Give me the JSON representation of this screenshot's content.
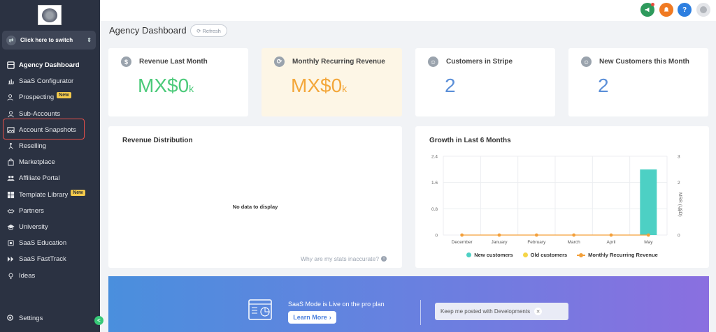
{
  "sidebar": {
    "switcher_label": "Click here to switch",
    "items": [
      {
        "label": "Agency Dashboard",
        "icon": "dashboard-icon",
        "active": true,
        "badge": ""
      },
      {
        "label": "SaaS Configurator",
        "icon": "chart-icon",
        "active": false,
        "badge": ""
      },
      {
        "label": "Prospecting",
        "icon": "users-search-icon",
        "active": false,
        "badge": "New"
      },
      {
        "label": "Sub-Accounts",
        "icon": "user-icon",
        "active": false,
        "badge": ""
      },
      {
        "label": "Account Snapshots",
        "icon": "image-icon",
        "active": false,
        "badge": ""
      },
      {
        "label": "Reselling",
        "icon": "network-icon",
        "active": false,
        "badge": ""
      },
      {
        "label": "Marketplace",
        "icon": "bag-icon",
        "active": false,
        "badge": ""
      },
      {
        "label": "Affiliate Portal",
        "icon": "group-icon",
        "active": false,
        "badge": ""
      },
      {
        "label": "Template Library",
        "icon": "templates-icon",
        "active": false,
        "badge": "New"
      },
      {
        "label": "Partners",
        "icon": "handshake-icon",
        "active": false,
        "badge": ""
      },
      {
        "label": "University",
        "icon": "graduation-icon",
        "active": false,
        "badge": ""
      },
      {
        "label": "SaaS Education",
        "icon": "education-icon",
        "active": false,
        "badge": ""
      },
      {
        "label": "SaaS FastTrack",
        "icon": "fast-forward-icon",
        "active": false,
        "badge": ""
      },
      {
        "label": "Ideas",
        "icon": "lightbulb-icon",
        "active": false,
        "badge": ""
      }
    ],
    "settings_label": "Settings",
    "collapse_glyph": "<"
  },
  "header": {
    "title": "Agency Dashboard",
    "refresh_label": "Refresh"
  },
  "stats": [
    {
      "label": "Revenue Last Month",
      "value": "MX$0",
      "suffix": "k",
      "icon": "dollar-icon",
      "color": "#4cca7a"
    },
    {
      "label": "Monthly Recurring Revenue",
      "value": "MX$0",
      "suffix": "k",
      "icon": "refresh-icon",
      "color": "#f3a73b"
    },
    {
      "label": "Customers in Stripe",
      "value": "2",
      "suffix": "",
      "icon": "user-icon",
      "color": "#5b8fd8"
    },
    {
      "label": "New Customers this Month",
      "value": "2",
      "suffix": "",
      "icon": "user-add-icon",
      "color": "#5b8fd8"
    }
  ],
  "revenue_distribution": {
    "title": "Revenue Distribution",
    "empty_text": "No data to display",
    "stats_link": "Why are my stats inaccurate?"
  },
  "growth": {
    "title": "Growth in Last 6 Months",
    "right_axis_label": "MRR (USD)",
    "legend": [
      {
        "label": "New customers",
        "color": "#4dd0c4"
      },
      {
        "label": "Old customers",
        "color": "#f5d547"
      },
      {
        "label": "Monthly Recurring Revenue",
        "color": "#f3a03b"
      }
    ]
  },
  "chart_data": {
    "type": "bar",
    "title": "Growth in Last 6 Months",
    "categories": [
      "December",
      "January",
      "February",
      "March",
      "April",
      "May"
    ],
    "series": [
      {
        "name": "New customers",
        "values": [
          0,
          0,
          0,
          0,
          0,
          2
        ],
        "axis": "left",
        "kind": "bar",
        "color": "#4dd0c4"
      },
      {
        "name": "Old customers",
        "values": [
          0,
          0,
          0,
          0,
          0,
          0
        ],
        "axis": "left",
        "kind": "bar",
        "color": "#f5d547"
      },
      {
        "name": "Monthly Recurring Revenue",
        "values": [
          0,
          0,
          0,
          0,
          0,
          0
        ],
        "axis": "right",
        "kind": "line",
        "color": "#f3a03b"
      }
    ],
    "ylim": [
      0,
      2.4
    ],
    "yticks": [
      "0",
      "0.8",
      "1.6",
      "2.4"
    ],
    "ylim_right": [
      0,
      3
    ],
    "yticks_right": [
      "0",
      "1",
      "2",
      "3"
    ],
    "ylabel_right": "MRR (USD)",
    "grid": true,
    "legend_position": "bottom"
  },
  "banner": {
    "text": "SaaS Mode is Live on the pro plan",
    "learn_more": "Learn More",
    "keep_posted": "Keep me posted with Developments"
  },
  "topbar": {
    "help_glyph": "?"
  }
}
